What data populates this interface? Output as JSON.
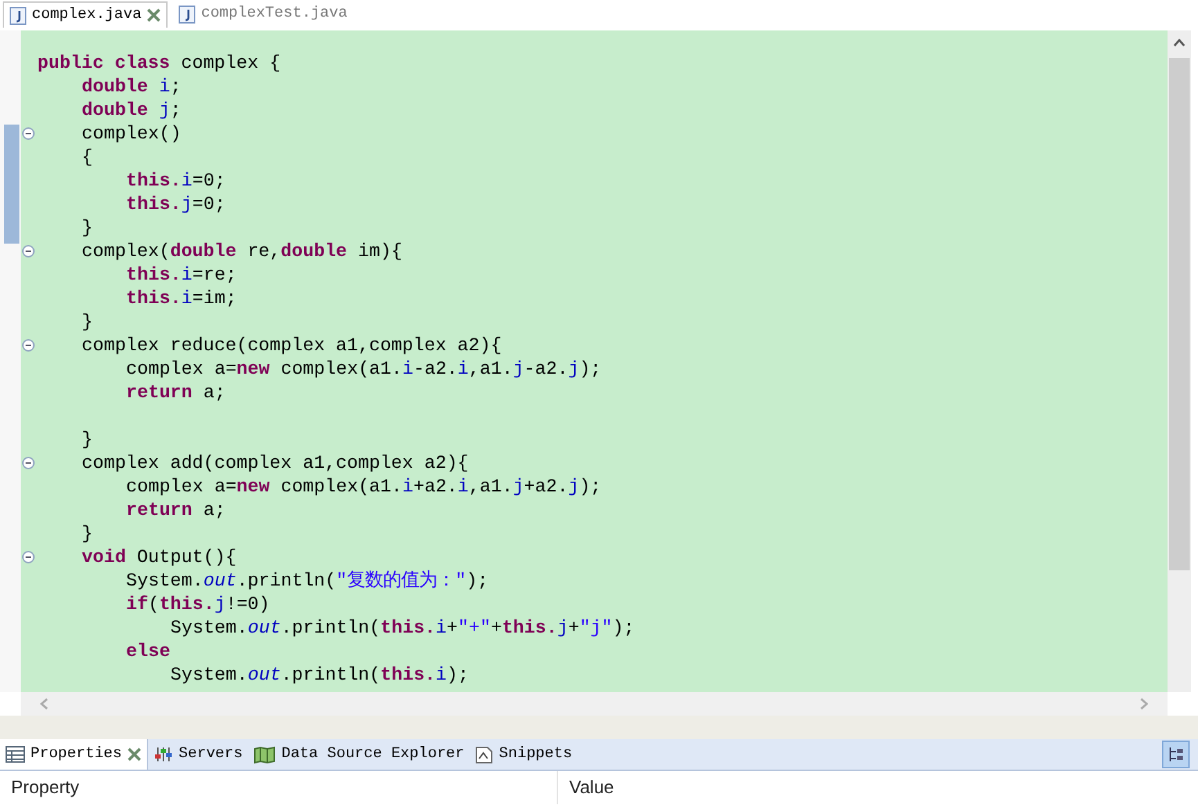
{
  "editor_tabs": [
    {
      "label": "complex.java",
      "selected": true,
      "closable": true
    },
    {
      "label": "complexTest.java",
      "selected": false,
      "closable": false
    }
  ],
  "code_lines": [
    {
      "foldable": false,
      "tokens": [
        {
          "kind": "kw",
          "text": "public "
        },
        {
          "kind": "kw",
          "text": "class"
        },
        {
          "kind": "plain",
          "text": " complex {"
        }
      ],
      "children": [
        {
          "foldable": false,
          "tokens": [
            {
              "kind": "kw",
              "text": "double "
            },
            {
              "kind": "field",
              "text": "i"
            },
            {
              "kind": "plain",
              "text": ";"
            }
          ]
        },
        {
          "foldable": false,
          "tokens": [
            {
              "kind": "kw",
              "text": "double "
            },
            {
              "kind": "field",
              "text": "j"
            },
            {
              "kind": "plain",
              "text": ";"
            }
          ]
        },
        {
          "foldable": true,
          "tokens": [
            {
              "kind": "plain",
              "text": "complex()"
            }
          ]
        },
        {
          "foldable": false,
          "tokens": [
            {
              "kind": "plain",
              "text": "{"
            }
          ],
          "children": [
            {
              "foldable": false,
              "tokens": [
                {
                  "kind": "kw",
                  "text": "this."
                },
                {
                  "kind": "field",
                  "text": "i"
                },
                {
                  "kind": "plain",
                  "text": "=0;"
                }
              ]
            },
            {
              "foldable": false,
              "tokens": [
                {
                  "kind": "kw",
                  "text": "this."
                },
                {
                  "kind": "field",
                  "text": "j"
                },
                {
                  "kind": "plain",
                  "text": "=0;"
                }
              ]
            }
          ]
        },
        {
          "foldable": false,
          "tokens": [
            {
              "kind": "plain",
              "text": "}"
            }
          ]
        },
        {
          "foldable": true,
          "tokens": [
            {
              "kind": "plain",
              "text": "complex("
            },
            {
              "kind": "kw",
              "text": "double "
            },
            {
              "kind": "plain",
              "text": "re,"
            },
            {
              "kind": "kw",
              "text": "double "
            },
            {
              "kind": "plain",
              "text": "im){"
            }
          ],
          "children": [
            {
              "foldable": false,
              "tokens": [
                {
                  "kind": "kw",
                  "text": "this."
                },
                {
                  "kind": "field",
                  "text": "i"
                },
                {
                  "kind": "plain",
                  "text": "=re;"
                }
              ]
            },
            {
              "foldable": false,
              "tokens": [
                {
                  "kind": "kw",
                  "text": "this."
                },
                {
                  "kind": "field",
                  "text": "i"
                },
                {
                  "kind": "plain",
                  "text": "=im;"
                }
              ]
            }
          ]
        },
        {
          "foldable": false,
          "tokens": [
            {
              "kind": "plain",
              "text": "}"
            }
          ]
        },
        {
          "foldable": true,
          "tokens": [
            {
              "kind": "plain",
              "text": "complex reduce(complex a1,complex a2){"
            }
          ],
          "children": [
            {
              "foldable": false,
              "tokens": [
                {
                  "kind": "plain",
                  "text": "complex a="
                },
                {
                  "kind": "kw",
                  "text": "new "
                },
                {
                  "kind": "plain",
                  "text": "complex(a1."
                },
                {
                  "kind": "field",
                  "text": "i"
                },
                {
                  "kind": "plain",
                  "text": "-a2."
                },
                {
                  "kind": "field",
                  "text": "i"
                },
                {
                  "kind": "plain",
                  "text": ",a1."
                },
                {
                  "kind": "field",
                  "text": "j"
                },
                {
                  "kind": "plain",
                  "text": "-a2."
                },
                {
                  "kind": "field",
                  "text": "j"
                },
                {
                  "kind": "plain",
                  "text": ");"
                }
              ]
            },
            {
              "foldable": false,
              "tokens": [
                {
                  "kind": "kw",
                  "text": "return "
                },
                {
                  "kind": "plain",
                  "text": "a;"
                }
              ]
            },
            {
              "foldable": false
            }
          ]
        },
        {
          "foldable": false,
          "tokens": [
            {
              "kind": "plain",
              "text": "}"
            }
          ]
        },
        {
          "foldable": true,
          "tokens": [
            {
              "kind": "plain",
              "text": "complex add(complex a1,complex a2){"
            }
          ],
          "children": [
            {
              "foldable": false,
              "tokens": [
                {
                  "kind": "plain",
                  "text": "complex a="
                },
                {
                  "kind": "kw",
                  "text": "new "
                },
                {
                  "kind": "plain",
                  "text": "complex(a1."
                },
                {
                  "kind": "field",
                  "text": "i"
                },
                {
                  "kind": "plain",
                  "text": "+a2."
                },
                {
                  "kind": "field",
                  "text": "i"
                },
                {
                  "kind": "plain",
                  "text": ",a1."
                },
                {
                  "kind": "field",
                  "text": "j"
                },
                {
                  "kind": "plain",
                  "text": "+a2."
                },
                {
                  "kind": "field",
                  "text": "j"
                },
                {
                  "kind": "plain",
                  "text": ");"
                }
              ]
            },
            {
              "foldable": false,
              "tokens": [
                {
                  "kind": "kw",
                  "text": "return "
                },
                {
                  "kind": "plain",
                  "text": "a;"
                }
              ]
            }
          ]
        },
        {
          "foldable": false,
          "tokens": [
            {
              "kind": "plain",
              "text": "}"
            }
          ]
        },
        {
          "foldable": true,
          "tokens": [
            {
              "kind": "kw",
              "text": "void "
            },
            {
              "kind": "plain",
              "text": "Output(){"
            }
          ],
          "children": [
            {
              "foldable": false,
              "tokens": [
                {
                  "kind": "plain",
                  "text": "System."
                },
                {
                  "kind": "static",
                  "text": "out"
                },
                {
                  "kind": "plain",
                  "text": ".println("
                },
                {
                  "kind": "str",
                  "text": "\"复数的值为：\""
                },
                {
                  "kind": "plain",
                  "text": ");"
                }
              ]
            },
            {
              "foldable": false,
              "tokens": [
                {
                  "kind": "kw",
                  "text": "if"
                },
                {
                  "kind": "plain",
                  "text": "("
                },
                {
                  "kind": "kw",
                  "text": "this."
                },
                {
                  "kind": "field",
                  "text": "j"
                },
                {
                  "kind": "plain",
                  "text": "!=0)"
                }
              ],
              "children": [
                {
                  "foldable": false,
                  "tokens": [
                    {
                      "kind": "plain",
                      "text": "System."
                    },
                    {
                      "kind": "static",
                      "text": "out"
                    },
                    {
                      "kind": "plain",
                      "text": ".println("
                    },
                    {
                      "kind": "kw",
                      "text": "this."
                    },
                    {
                      "kind": "field",
                      "text": "i"
                    },
                    {
                      "kind": "plain",
                      "text": "+"
                    },
                    {
                      "kind": "str",
                      "text": "\"+\""
                    },
                    {
                      "kind": "plain",
                      "text": "+"
                    },
                    {
                      "kind": "kw",
                      "text": "this."
                    },
                    {
                      "kind": "field",
                      "text": "j"
                    },
                    {
                      "kind": "plain",
                      "text": "+"
                    },
                    {
                      "kind": "str",
                      "text": "\"j\""
                    },
                    {
                      "kind": "plain",
                      "text": ");"
                    }
                  ]
                }
              ]
            },
            {
              "foldable": false,
              "tokens": [
                {
                  "kind": "kw",
                  "text": "else"
                }
              ],
              "children": [
                {
                  "foldable": false,
                  "tokens": [
                    {
                      "kind": "plain",
                      "text": "System."
                    },
                    {
                      "kind": "static",
                      "text": "out"
                    },
                    {
                      "kind": "plain",
                      "text": ".println("
                    },
                    {
                      "kind": "kw",
                      "text": "this."
                    },
                    {
                      "kind": "field",
                      "text": "i"
                    },
                    {
                      "kind": "plain",
                      "text": ");"
                    }
                  ]
                }
              ]
            }
          ]
        }
      ]
    }
  ],
  "panel_tabs": [
    {
      "label": "Properties",
      "selected": true,
      "closable": true
    },
    {
      "label": "Servers",
      "selected": false,
      "closable": false
    },
    {
      "label": "Data Source Explorer",
      "selected": false,
      "closable": false
    },
    {
      "label": "Snippets",
      "selected": false,
      "closable": false
    }
  ],
  "properties_table": {
    "columns": [
      "Property",
      "Value"
    ]
  }
}
